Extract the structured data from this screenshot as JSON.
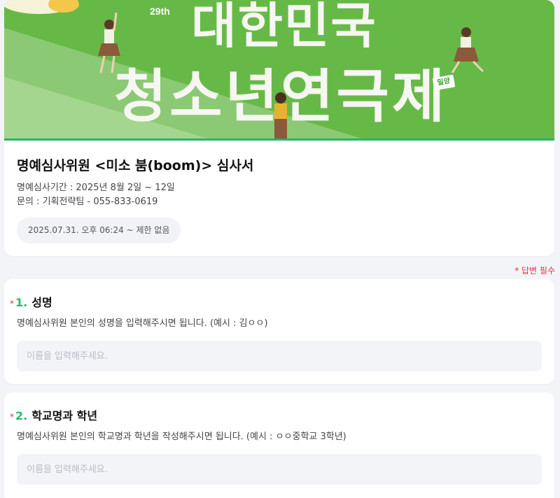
{
  "banner": {
    "edition": "29th",
    "title_line1": "대한민국",
    "title_line2": "청소년연극제",
    "badge": "밀양"
  },
  "form": {
    "title": "명예심사위원 <미소 붐(boom)>  심사서",
    "period": "명예심사기간 : 2025년 8월 2일 ~ 12일",
    "contact": "문의 : 기획전략팀 - 055-833-0619",
    "date_range": "2025.07.31. 오후 06:24 ~ 제한 없음",
    "required_note": "* 답변 필수"
  },
  "questions": [
    {
      "star": "*",
      "number": "1.",
      "title": "성명",
      "description": "명예심사위원 본인의 성명을 입력해주시면 됩니다. (예시 : 김ㅇㅇ)",
      "placeholder": "이름을 입력해주세요.",
      "value": ""
    },
    {
      "star": "*",
      "number": "2.",
      "title": "학교명과 학년",
      "description": "명예심사위원 본인의 학교명과 학년을 작성해주시면 됩니다. (예시 : ㅇㅇ중학교 3학년)",
      "placeholder": "이름을 입력해주세요.",
      "value": ""
    }
  ],
  "colors": {
    "banner_green": "#67b947",
    "accent_green": "#1fbf6a",
    "required_red": "#e5333e",
    "page_bg": "#f3f4f8"
  }
}
